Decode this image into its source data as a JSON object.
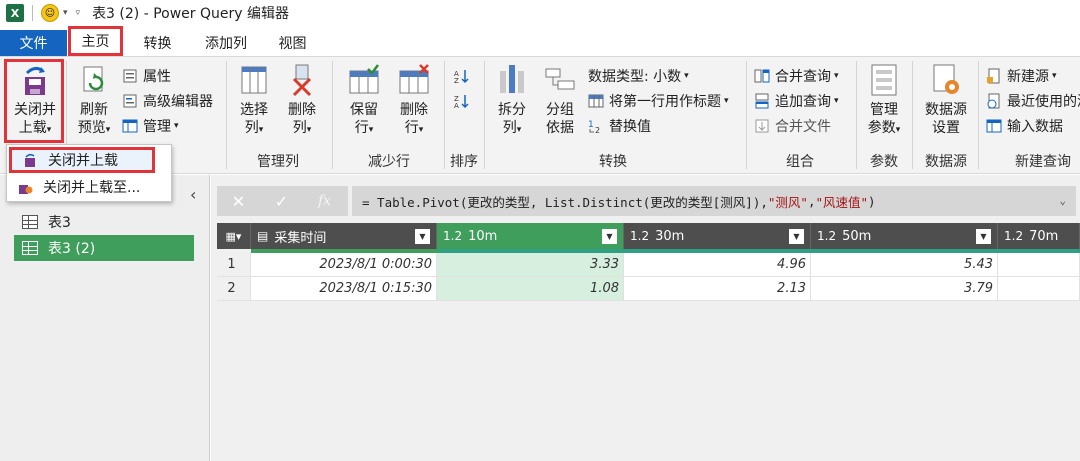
{
  "window": {
    "app_icon": "X",
    "title": "表3 (2) - Power Query 编辑器"
  },
  "menu": {
    "file": "文件",
    "tabs": [
      "主页",
      "转换",
      "添加列",
      "视图"
    ]
  },
  "ribbon": {
    "close_load_line1": "关闭并",
    "close_load_line2": "上载",
    "refresh_line1": "刷新",
    "refresh_line2": "预览",
    "properties": "属性",
    "advanced_editor": "高级编辑器",
    "manage": "管理",
    "choose_columns_line1": "选择",
    "choose_columns_line2": "列",
    "remove_columns_line1": "删除",
    "remove_columns_line2": "列",
    "group_manage_columns": "管理列",
    "keep_rows_line1": "保留",
    "keep_rows_line2": "行",
    "remove_rows_line1": "删除",
    "remove_rows_line2": "行",
    "group_reduce_rows": "减少行",
    "group_sort": "排序",
    "split_column_line1": "拆分",
    "split_column_line2": "列",
    "group_by_line1": "分组",
    "group_by_line2": "依据",
    "data_type": "数据类型: 小数",
    "use_first_row": "将第一行用作标题",
    "replace_values": "替换值",
    "group_transform": "转换",
    "merge_queries": "合并查询",
    "append_queries": "追加查询",
    "combine_files": "合并文件",
    "group_combine": "组合",
    "manage_params_line1": "管理",
    "manage_params_line2": "参数",
    "group_params": "参数",
    "data_source_line1": "数据源",
    "data_source_line2": "设置",
    "group_data_source": "数据源",
    "new_source": "新建源",
    "recent_sources": "最近使用的源",
    "enter_data": "输入数据",
    "group_new_query": "新建查询"
  },
  "dropdown": {
    "items": [
      "关闭并上载",
      "关闭并上载至..."
    ]
  },
  "queries": {
    "items": [
      "表3",
      "表3 (2)"
    ],
    "selected_index": 1
  },
  "formula_bar": {
    "fx": "fx",
    "prefix": "= Table.Pivot(更改的类型, List.Distinct(更改的类型[测风]), ",
    "arg1": "\"测风\"",
    "sep": ", ",
    "arg2": "\"风速值\"",
    "suffix": ")"
  },
  "table": {
    "columns": [
      {
        "type": "",
        "name": "采集时间"
      },
      {
        "type": "1.2",
        "name": "10m"
      },
      {
        "type": "1.2",
        "name": "30m"
      },
      {
        "type": "1.2",
        "name": "50m"
      },
      {
        "type": "1.2",
        "name": "70m"
      }
    ],
    "rows": [
      {
        "num": "1",
        "cells": [
          "2023/8/1 0:00:30",
          "3.33",
          "4.96",
          "5.43",
          ""
        ]
      },
      {
        "num": "2",
        "cells": [
          "2023/8/1 0:15:30",
          "1.08",
          "2.13",
          "3.79",
          ""
        ]
      }
    ],
    "selected_column": 1
  },
  "colors": {
    "accent_red": "#e2323a",
    "file_tab_blue": "#1565c0",
    "selected_green": "#3f9e5b"
  }
}
